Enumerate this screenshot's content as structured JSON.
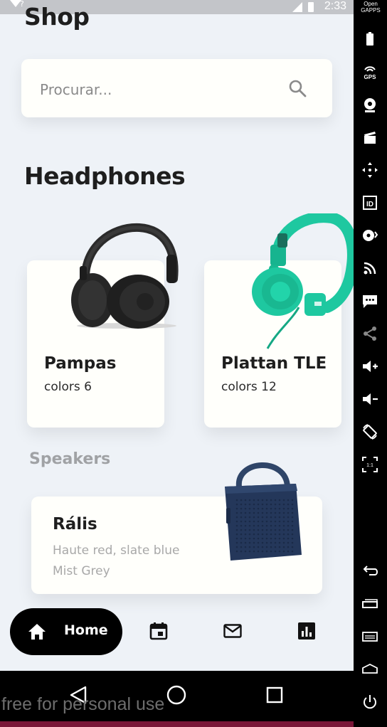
{
  "status_bar": {
    "time": "2:33",
    "indicator": "?"
  },
  "shop": {
    "title": "Shop"
  },
  "search": {
    "placeholder": "Procurar..."
  },
  "headphones": {
    "title": "Headphones",
    "products": [
      {
        "name": "Pampas",
        "colors": "colors 6",
        "image": "black-headphones"
      },
      {
        "name": "Plattan TLE",
        "colors": "colors 12",
        "image": "green-headphones"
      }
    ]
  },
  "speakers": {
    "title": "Speakers",
    "products": [
      {
        "name": "Rális",
        "line1": "Haute red, slate blue",
        "line2": "Mist Grey",
        "image": "blue-speaker"
      }
    ]
  },
  "bottom_nav": {
    "items": [
      {
        "label": "Home",
        "icon": "home-icon",
        "active": true
      },
      {
        "icon": "calendar-icon"
      },
      {
        "icon": "mail-icon"
      },
      {
        "icon": "bar-chart-icon"
      }
    ]
  },
  "emulator_sidebar": {
    "label": "Open GAPPS",
    "icons": [
      "battery-icon",
      "gps-icon",
      "camera-icon",
      "clapper-icon",
      "move-icon",
      "id-icon",
      "disc-icon",
      "rss-icon",
      "sms-icon",
      "share-icon",
      "volume-up-icon",
      "volume-down-icon",
      "rotate-icon",
      "fullscreen-icon",
      "back-icon",
      "recents-icon",
      "menu-icon",
      "home-icon",
      "power-icon"
    ]
  },
  "android_nav": [
    "back-triangle-icon",
    "home-circle-icon",
    "recents-square-icon"
  ],
  "watermark": "free for personal use",
  "colors": {
    "background": "#eef2f7",
    "card": "#fffffb",
    "nav_pill": "#000000",
    "accent_green": "#1ec8a0",
    "speaker_blue": "#24375a"
  }
}
